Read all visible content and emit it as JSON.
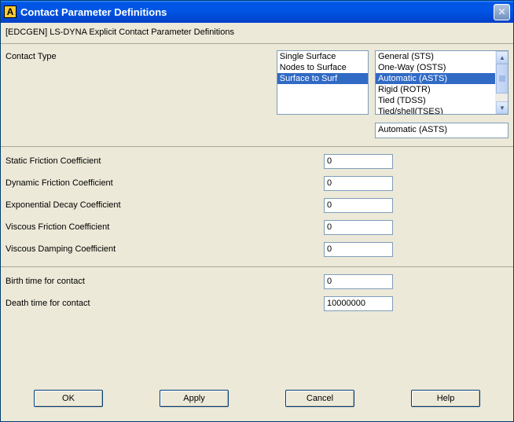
{
  "window": {
    "title": "Contact Parameter Definitions",
    "app_icon_letter": "A"
  },
  "subheader": "[EDCGEN]  LS-DYNA Explicit Contact Parameter Definitions",
  "contact_type": {
    "label": "Contact Type",
    "list1": {
      "items": [
        "Single Surface",
        "Nodes to Surface",
        "Surface to Surf"
      ],
      "selected_index": 2
    },
    "list2": {
      "items": [
        "General (STS)",
        "One-Way (OSTS)",
        "Automatic (ASTS)",
        "Rigid (ROTR)",
        "Tied (TDSS)",
        "Tied/shell(TSES)"
      ],
      "selected_index": 2
    },
    "selected_display": "Automatic (ASTS)"
  },
  "friction": {
    "static": {
      "label": "Static Friction Coefficient",
      "value": "0"
    },
    "dynamic": {
      "label": "Dynamic Friction Coefficient",
      "value": "0"
    },
    "decay": {
      "label": "Exponential Decay Coefficient",
      "value": "0"
    },
    "viscous_friction": {
      "label": "Viscous Friction Coefficient",
      "value": "0"
    },
    "viscous_damping": {
      "label": "Viscous Damping Coefficient",
      "value": "0"
    }
  },
  "times": {
    "birth": {
      "label": "Birth time for contact",
      "value": "0"
    },
    "death": {
      "label": "Death time for contact",
      "value": "10000000"
    }
  },
  "buttons": {
    "ok": "OK",
    "apply": "Apply",
    "cancel": "Cancel",
    "help": "Help"
  }
}
